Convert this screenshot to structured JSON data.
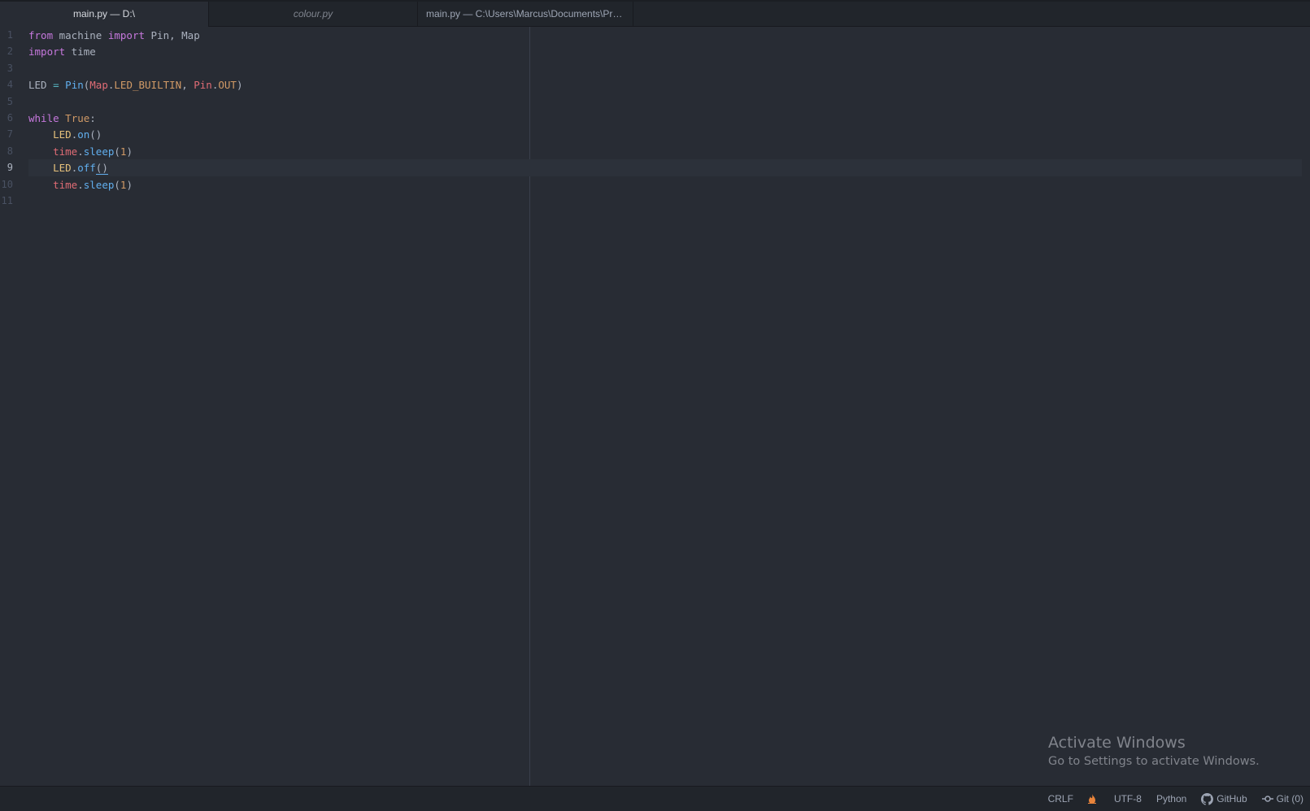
{
  "tabs": [
    {
      "label": "main.py — D:\\",
      "active": true
    },
    {
      "label": "colour.py",
      "pending": true
    },
    {
      "label": "main.py — C:\\Users\\Marcus\\Documents\\Pro..."
    }
  ],
  "editor": {
    "cursor_line": 9,
    "lines": [
      {
        "num": "1",
        "tokens": [
          [
            "kw",
            "from"
          ],
          [
            "plain",
            " machine "
          ],
          [
            "kw",
            "import"
          ],
          [
            "plain",
            " Pin, Map"
          ]
        ]
      },
      {
        "num": "2",
        "tokens": [
          [
            "kw",
            "import"
          ],
          [
            "plain",
            " time"
          ]
        ]
      },
      {
        "num": "3",
        "tokens": []
      },
      {
        "num": "4",
        "tokens": [
          [
            "plain",
            "LED "
          ],
          [
            "op",
            "="
          ],
          [
            "plain",
            " "
          ],
          [
            "fn",
            "Pin"
          ],
          [
            "plain",
            "("
          ],
          [
            "var",
            "Map"
          ],
          [
            "plain",
            "."
          ],
          [
            "const",
            "LED_BUILTIN"
          ],
          [
            "plain",
            ", "
          ],
          [
            "var",
            "Pin"
          ],
          [
            "plain",
            "."
          ],
          [
            "const",
            "OUT"
          ],
          [
            "plain",
            ")"
          ]
        ]
      },
      {
        "num": "5",
        "tokens": []
      },
      {
        "num": "6",
        "tokens": [
          [
            "kw",
            "while"
          ],
          [
            "plain",
            " "
          ],
          [
            "const",
            "True"
          ],
          [
            "plain",
            ":"
          ]
        ]
      },
      {
        "num": "7",
        "tokens": [
          [
            "plain",
            "    "
          ],
          [
            "cls",
            "LED"
          ],
          [
            "plain",
            "."
          ],
          [
            "fn",
            "on"
          ],
          [
            "plain",
            "()"
          ]
        ]
      },
      {
        "num": "8",
        "tokens": [
          [
            "plain",
            "    "
          ],
          [
            "var",
            "time"
          ],
          [
            "plain",
            "."
          ],
          [
            "fn",
            "sleep"
          ],
          [
            "plain",
            "("
          ],
          [
            "num",
            "1"
          ],
          [
            "plain",
            ")"
          ]
        ]
      },
      {
        "num": "9",
        "tokens": [
          [
            "plain",
            "    "
          ],
          [
            "cls",
            "LED"
          ],
          [
            "plain",
            "."
          ],
          [
            "fn",
            "off"
          ],
          [
            "bracket-match",
            "()"
          ]
        ]
      },
      {
        "num": "10",
        "tokens": [
          [
            "plain",
            "    "
          ],
          [
            "var",
            "time"
          ],
          [
            "plain",
            "."
          ],
          [
            "fn",
            "sleep"
          ],
          [
            "plain",
            "("
          ],
          [
            "num",
            "1"
          ],
          [
            "plain",
            ")"
          ]
        ]
      },
      {
        "num": "11",
        "tokens": []
      }
    ]
  },
  "watermark": {
    "title": "Activate Windows",
    "subtitle": "Go to Settings to activate Windows."
  },
  "status": {
    "line_ending": "CRLF",
    "encoding": "UTF-8",
    "grammar": "Python",
    "github": "GitHub",
    "git": "Git (0)"
  },
  "colors": {
    "background": "#282c34",
    "tabbar": "#21252b",
    "keyword": "#c678dd",
    "function": "#61afef",
    "variable": "#e06c75",
    "constant": "#d19a66",
    "class": "#e5c07b",
    "accent_icon": "#e8843b"
  },
  "icons": {
    "file_status": "flame-icon",
    "github": "github-octocat-icon",
    "git": "git-commit-icon"
  }
}
